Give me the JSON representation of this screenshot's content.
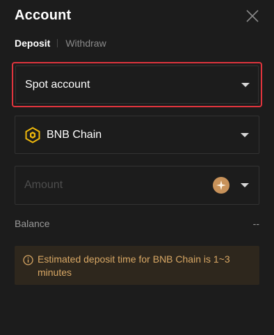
{
  "header": {
    "title": "Account",
    "close_icon": "close-icon"
  },
  "tabs": [
    {
      "label": "Deposit",
      "active": true
    },
    {
      "label": "Withdraw",
      "active": false
    }
  ],
  "account_select": {
    "value": "Spot account",
    "icon": "chevron-down-icon"
  },
  "network_select": {
    "value": "BNB Chain",
    "logo": "bnb-chain-icon",
    "icon": "chevron-down-icon"
  },
  "amount_input": {
    "value": "",
    "placeholder": "Amount",
    "token_icon": "token-icon"
  },
  "balance": {
    "label": "Balance",
    "value": "--"
  },
  "notice": {
    "icon": "info-icon",
    "text": "Estimated deposit time for BNB Chain is 1~3 minutes"
  },
  "colors": {
    "background": "#1c1c1c",
    "highlight_border": "#e0343d",
    "notice_bg": "#2e271d",
    "notice_text": "#d9a865",
    "bnb_yellow": "#f0b90b",
    "token_bronze": "#c8925a"
  }
}
